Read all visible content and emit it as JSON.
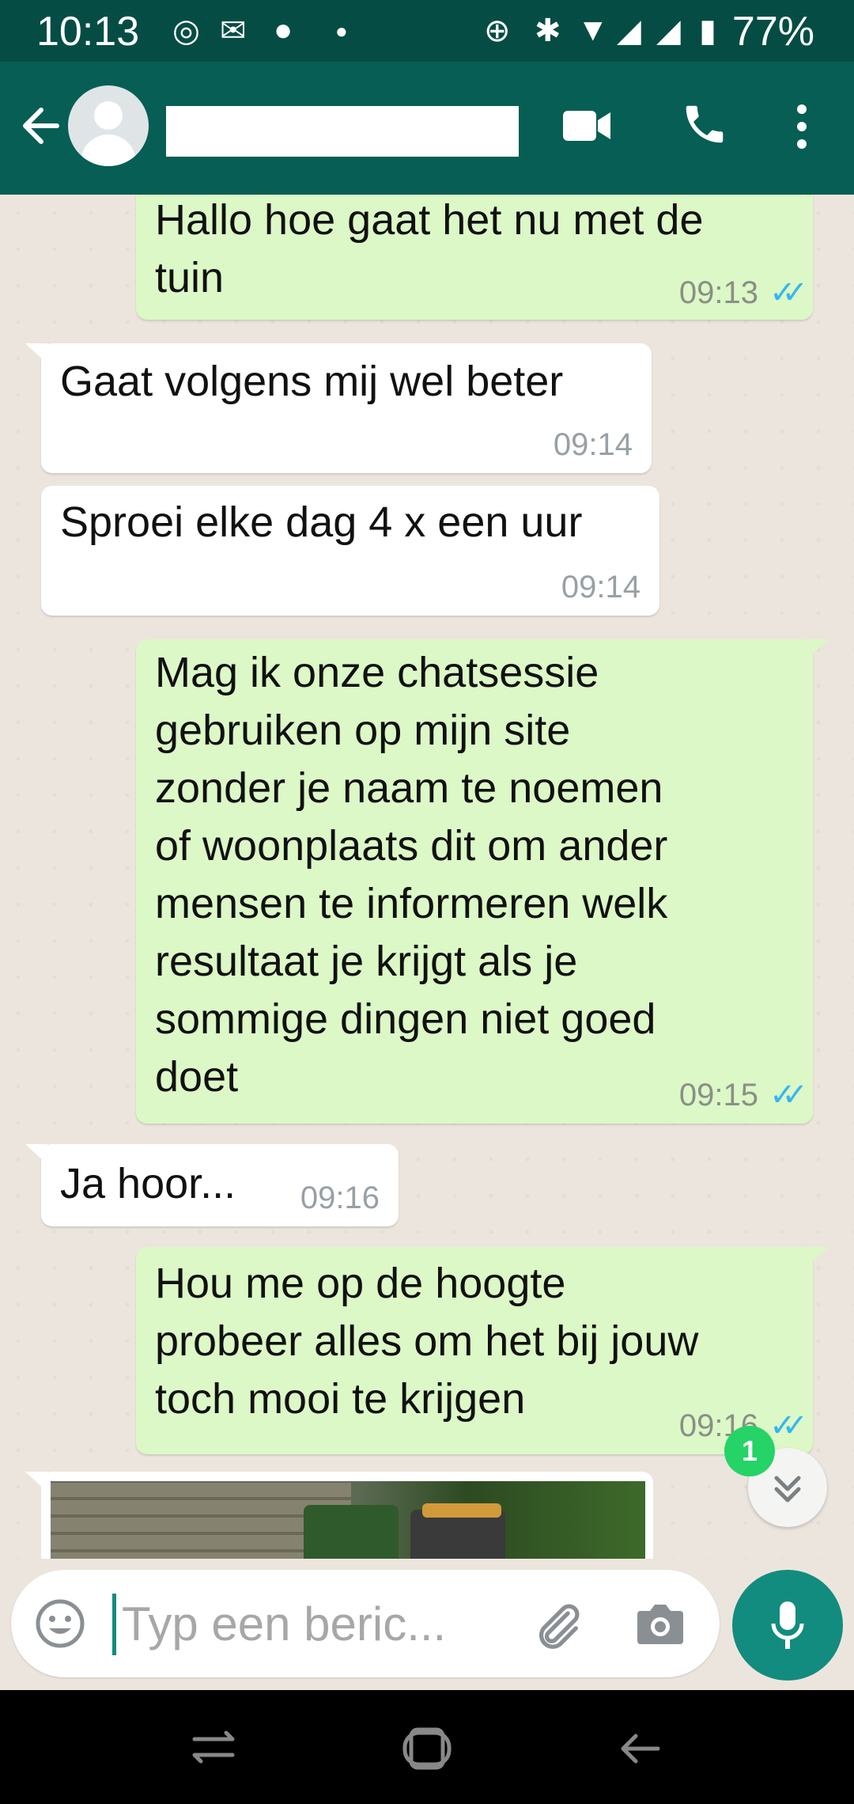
{
  "status_bar": {
    "time": "10:13",
    "battery": "77%"
  },
  "header": {
    "contact_name": ""
  },
  "messages": [
    {
      "direction": "out",
      "lines": [
        "Hallo hoe gaat het nu met de",
        "tuin"
      ],
      "time": "09:13",
      "read": true
    },
    {
      "direction": "in",
      "lines": [
        "Gaat volgens mij wel beter"
      ],
      "time": "09:14"
    },
    {
      "direction": "in",
      "lines": [
        "Sproei elke dag 4 x een uur"
      ],
      "time": "09:14"
    },
    {
      "direction": "out",
      "lines": [
        "Mag ik onze chatsessie",
        "gebruiken op mijn site",
        "zonder je naam te noemen",
        "of woonplaats dit om ander",
        "mensen te informeren welk",
        "resultaat je krijgt als je",
        "sommige dingen niet goed",
        "doet"
      ],
      "time": "09:15",
      "read": true
    },
    {
      "direction": "in",
      "lines": [
        "Ja hoor..."
      ],
      "time": "09:16"
    },
    {
      "direction": "out",
      "lines": [
        "Hou me op de hoogte",
        "probeer alles om het bij jouw",
        "toch mooi te krijgen"
      ],
      "time": "09:16",
      "read": true
    }
  ],
  "unread_badge": "1",
  "composer": {
    "placeholder": "Typ een beric..."
  },
  "icons": {
    "back": "arrow-left-icon",
    "video": "video-call-icon",
    "call": "phone-icon",
    "menu": "more-vert-icon",
    "emoji": "emoji-icon",
    "attach": "paperclip-icon",
    "camera": "camera-icon",
    "mic": "mic-icon"
  },
  "colors": {
    "header": "#075e54",
    "status_bar": "#054d44",
    "outgoing": "#dcf8c6",
    "accent": "#128c7e",
    "ticks": "#34b7f1"
  }
}
